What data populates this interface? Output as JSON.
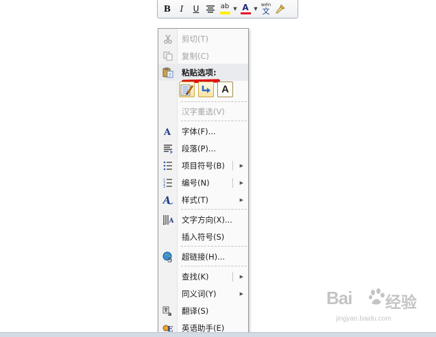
{
  "mini_toolbar": {
    "buttons": [
      {
        "id": "bold",
        "label": "B"
      },
      {
        "id": "italic",
        "label": "I"
      },
      {
        "id": "underline",
        "label": "U"
      },
      {
        "id": "align",
        "label": ""
      },
      {
        "id": "highlight",
        "label": "ab"
      },
      {
        "id": "font-color",
        "label": "A"
      },
      {
        "id": "phonetic",
        "label": "wén",
        "sub": "文"
      },
      {
        "id": "format-painter",
        "label": ""
      }
    ],
    "highlight_color": "#ffef00",
    "font_color": "#e81123"
  },
  "context_menu": {
    "items": [
      {
        "label": "剪切(T)",
        "icon": "scissors-icon",
        "disabled": true
      },
      {
        "label": "复制(C)",
        "icon": "copy-icon",
        "disabled": true
      },
      {
        "label": "粘贴选项:",
        "icon": "paste-icon",
        "header": true
      },
      {
        "label": "汉字重选(V)",
        "disabled": true
      },
      {
        "label": "字体(F)...",
        "icon": "font-icon"
      },
      {
        "label": "段落(P)...",
        "icon": "paragraph-icon"
      },
      {
        "label": "项目符号(B)",
        "icon": "bullets-icon",
        "submenu": true,
        "split": true
      },
      {
        "label": "编号(N)",
        "icon": "numbering-icon",
        "submenu": true,
        "split": true
      },
      {
        "label": "样式(T)",
        "icon": "styles-icon",
        "submenu": true
      },
      {
        "label": "文字方向(X)...",
        "icon": "text-direction-icon"
      },
      {
        "label": "插入符号(S)"
      },
      {
        "label": "超链接(H)...",
        "icon": "hyperlink-icon"
      },
      {
        "label": "查找(K)",
        "submenu": true,
        "split": true
      },
      {
        "label": "同义词(Y)",
        "submenu": true
      },
      {
        "label": "翻译(S)",
        "icon": "translate-icon"
      },
      {
        "label": "英语助手(E)",
        "icon": "english-assistant-icon"
      }
    ],
    "paste_options": [
      {
        "name": "keep-source-formatting"
      },
      {
        "name": "merge-formatting"
      },
      {
        "name": "keep-text-only",
        "label": "A"
      }
    ]
  },
  "watermark": {
    "logo": "Bai",
    "logo_end": "经验",
    "url": "jingyan.baidu.com"
  }
}
